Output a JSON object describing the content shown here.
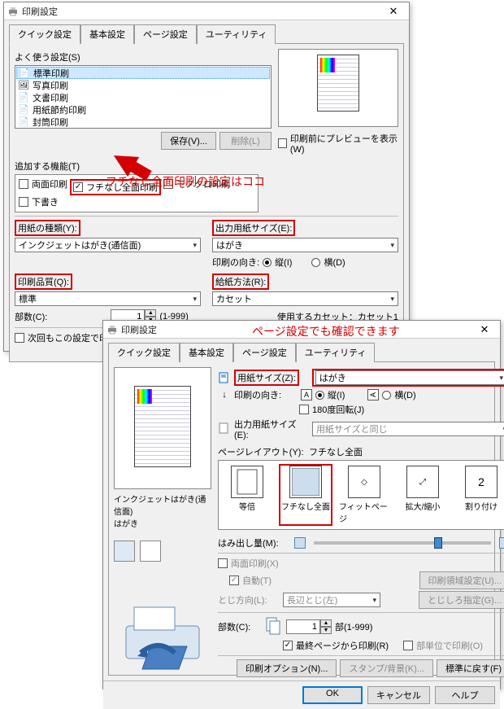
{
  "dialog1": {
    "title": "印刷設定",
    "tabs": [
      "クイック設定",
      "基本設定",
      "ページ設定",
      "ユーティリティ"
    ],
    "active_tab": 0,
    "freq_label": "よく使う設定(S)",
    "freq_items": [
      {
        "label": "標準印刷",
        "selected": true
      },
      {
        "label": "写真印刷",
        "selected": false
      },
      {
        "label": "文書印刷",
        "selected": false
      },
      {
        "label": "用紙節約印刷",
        "selected": false
      },
      {
        "label": "封筒印刷",
        "selected": false
      }
    ],
    "save_btn": "保存(V)...",
    "delete_btn": "削除(L)",
    "preview_chk": "印刷前にプレビューを表示(W)",
    "add_func_label": "追加する機能(T)",
    "add_funcs": [
      {
        "label": "両面印刷",
        "checked": false
      },
      {
        "label": "フチなし全面印刷",
        "checked": true,
        "highlight": true
      },
      {
        "label": "モノクロ印刷",
        "checked": false
      },
      {
        "label": "下書き",
        "checked": false
      }
    ],
    "paper_type_label": "用紙の種類(Y):",
    "paper_type_value": "インクジェットはがき(通信面)",
    "out_size_label": "出力用紙サイズ(E):",
    "out_size_value": "はがき",
    "orient_label": "印刷の向き:",
    "orient_portrait": "縦(I)",
    "orient_landscape": "横(D)",
    "quality_label": "印刷品質(Q):",
    "quality_value": "標準",
    "feed_label": "給紙方法(R):",
    "feed_value": "カセット",
    "copies_label": "部数(C):",
    "copies_value": "1",
    "copies_range": "(1-999)",
    "cassette_label": "使用するカセット：カセット1",
    "next_time_chk": "次回もこの設定で印刷",
    "annot1": "フチなし全面印刷の設定はココ"
  },
  "dialog2": {
    "title": "印刷設定",
    "tabs": [
      "クイック設定",
      "基本設定",
      "ページ設定",
      "ユーティリティ"
    ],
    "active_tab": 2,
    "annot2": "ページ設定でも確認できます",
    "paper_size_label": "用紙サイズ(Z):",
    "paper_size_value": "はがき",
    "orient_label": "印刷の向き:",
    "orient_portrait": "縦(I)",
    "orient_landscape": "横(D)",
    "rotate_chk": "180度回転(J)",
    "out_size_label": "出力用紙サイズ(E):",
    "out_size_value": "用紙サイズと同じ",
    "layout_label": "ページレイアウト(Y):",
    "layout_value": "フチなし全面",
    "layout_items": [
      "等倍",
      "フチなし全面",
      "フィットページ",
      "拡大/縮小",
      "割り付け"
    ],
    "layout_selected": 1,
    "ext_label": "はみ出し量(M):",
    "duplex_chk": "両面印刷(X)",
    "auto_chk": "自動(T)",
    "print_area_btn": "印刷領域設定(U)...",
    "bind_label": "とじ方向(L):",
    "bind_value": "長辺とじ(左)",
    "margin_btn": "とじしろ指定(G)...",
    "copies_label": "部数(C):",
    "copies_value": "1",
    "copies_range": "部(1-999)",
    "last_page_chk": "最終ページから印刷(R)",
    "unit_chk": "部単位で印刷(O)",
    "print_opt_btn": "印刷オプション(N)...",
    "stamp_btn": "スタンプ/背景(K)...",
    "defaults_btn": "標準に戻す(F)",
    "preview_line1": "インクジェットはがき(通信面)",
    "preview_line2": "はがき",
    "ok": "OK",
    "cancel": "キャンセル",
    "help": "ヘルプ"
  }
}
